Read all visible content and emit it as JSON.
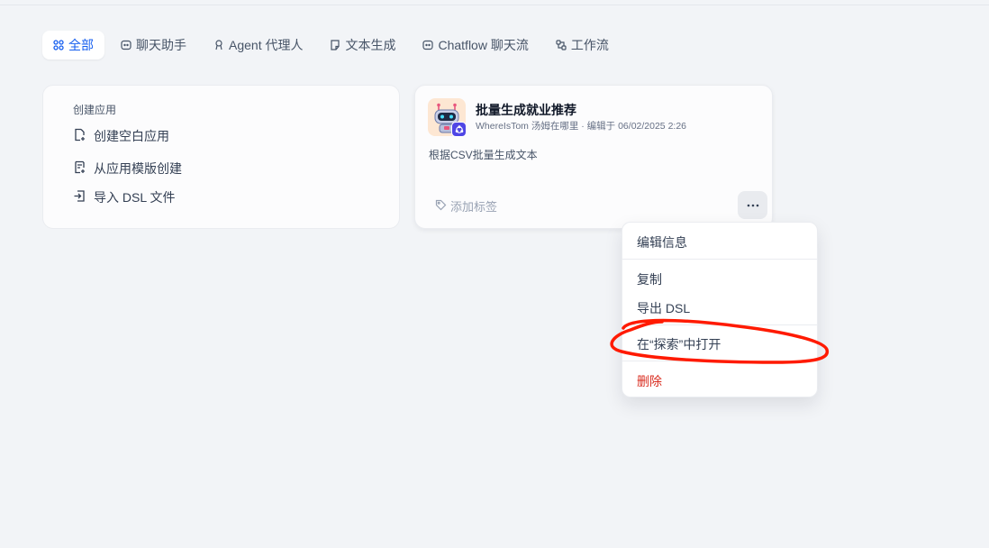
{
  "tabs": [
    {
      "label": "全部",
      "icon": "grid-icon",
      "active": true
    },
    {
      "label": "聊天助手",
      "icon": "chat-icon"
    },
    {
      "label": "Agent  代理人",
      "icon": "agent-icon"
    },
    {
      "label": "文本生成",
      "icon": "document-icon"
    },
    {
      "label": "Chatflow  聊天流",
      "icon": "chatflow-icon"
    },
    {
      "label": "工作流",
      "icon": "workflow-icon"
    }
  ],
  "create": {
    "title": "创建应用",
    "items": [
      {
        "label": "创建空白应用",
        "icon": "file-plus-icon"
      },
      {
        "label": "从应用模版创建",
        "icon": "template-icon"
      },
      {
        "label": "导入 DSL 文件",
        "icon": "import-icon"
      }
    ]
  },
  "app": {
    "name": "批量生成就业推荐",
    "meta": "WhereIsTom  汤姆在哪里 · 编辑于 06/02/2025 2:26",
    "description": "根据CSV批量生成文本",
    "tag_label": "添加标签",
    "icon": "robot-icon",
    "accent": "#4f46e5"
  },
  "menu": {
    "items": [
      {
        "label": "编辑信息"
      },
      {
        "label": "复制"
      },
      {
        "label": "导出 DSL"
      },
      {
        "label": "在“探索”中打开"
      },
      {
        "label": "删除",
        "danger": true
      }
    ]
  },
  "colors": {
    "primary": "#155eef",
    "danger": "#d92d20",
    "annotation": "#ff1a00",
    "background": "#f2f4f7"
  }
}
